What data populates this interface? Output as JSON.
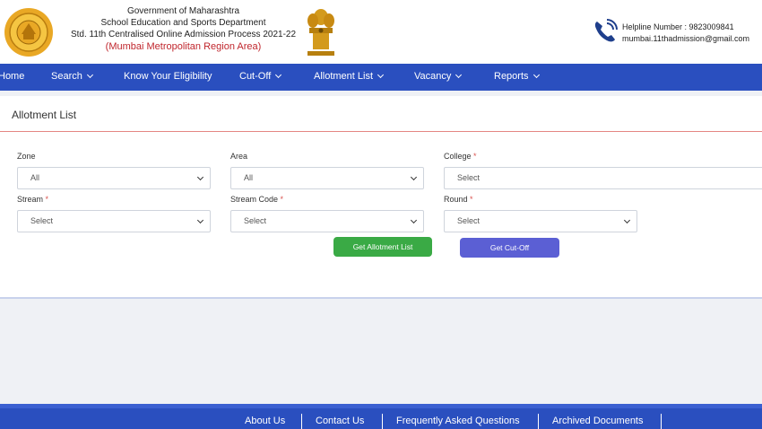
{
  "header": {
    "line1": "Government of Maharashtra",
    "line2": "School Education and Sports Department",
    "line3": "Std. 11th Centralised Online Admission Process 2021-22",
    "region": "(Mumbai Metropolitan Region Area)",
    "helpline": "Helpline Number : 9823009841",
    "email": "mumbai.11thadmission@gmail.com"
  },
  "nav": {
    "home": "Home",
    "search": "Search",
    "eligibility": "Know Your Eligibility",
    "cutoff": "Cut-Off",
    "allotment": "Allotment List",
    "vacancy": "Vacancy",
    "reports": "Reports"
  },
  "card": {
    "title": "Allotment List",
    "zone_label": "Zone",
    "zone_value": "All",
    "area_label": "Area",
    "area_value": "All",
    "college_label": "College",
    "college_value": "Select",
    "stream_label": "Stream",
    "stream_value": "Select",
    "stream_code_label": "Stream Code",
    "stream_code_value": "Select",
    "round_label": "Round",
    "round_value": "Select",
    "required_mark": "*",
    "get_allotment": "Get Allotment List",
    "get_cutoff": "Get Cut-Off"
  },
  "footer": {
    "about": "About Us",
    "contact": "Contact Us",
    "faq": "Frequently Asked Questions",
    "archived": "Archived Documents"
  },
  "colors": {
    "nav_bg": "#2a4fbf",
    "required": "#d9534f",
    "green_button": "#3aaa45",
    "purple_button": "#5b5fd4",
    "region_text": "#c0262d"
  }
}
